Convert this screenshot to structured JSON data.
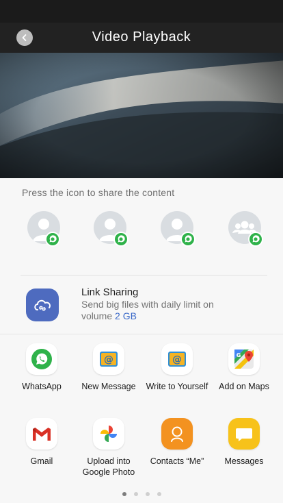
{
  "header": {
    "title": "Video Playback"
  },
  "share": {
    "prompt": "Press the icon to share the content",
    "contacts": [
      {
        "kind": "person",
        "badge": "whatsapp"
      },
      {
        "kind": "person",
        "badge": "whatsapp"
      },
      {
        "kind": "person",
        "badge": "whatsapp"
      },
      {
        "kind": "group",
        "badge": "whatsapp"
      }
    ],
    "link_sharing": {
      "title": "Link Sharing",
      "desc": "Send big files with daily limit on volume",
      "limit": "2 GB"
    },
    "apps": [
      {
        "label": "WhatsApp",
        "icon": "whatsapp-icon"
      },
      {
        "label": "New Message",
        "icon": "email-icon"
      },
      {
        "label": "Write to Yourself",
        "icon": "email-icon"
      },
      {
        "label": "Add on Maps",
        "icon": "maps-icon"
      },
      {
        "label": "Gmail",
        "icon": "gmail-icon"
      },
      {
        "label": "Upload into Google Photo",
        "icon": "google-photos-icon"
      },
      {
        "label": "Contacts “Me”",
        "icon": "contacts-icon"
      },
      {
        "label": "Messages",
        "icon": "messages-icon"
      }
    ],
    "pager": {
      "count": 4,
      "active": 0
    }
  },
  "colors": {
    "whatsapp_green": "#2fb24a",
    "link_accent": "#3a69c8",
    "link_icon_bg": "#4e6bbf",
    "contacts_orange": "#f39220",
    "messages_yellow": "#f7c21a"
  }
}
